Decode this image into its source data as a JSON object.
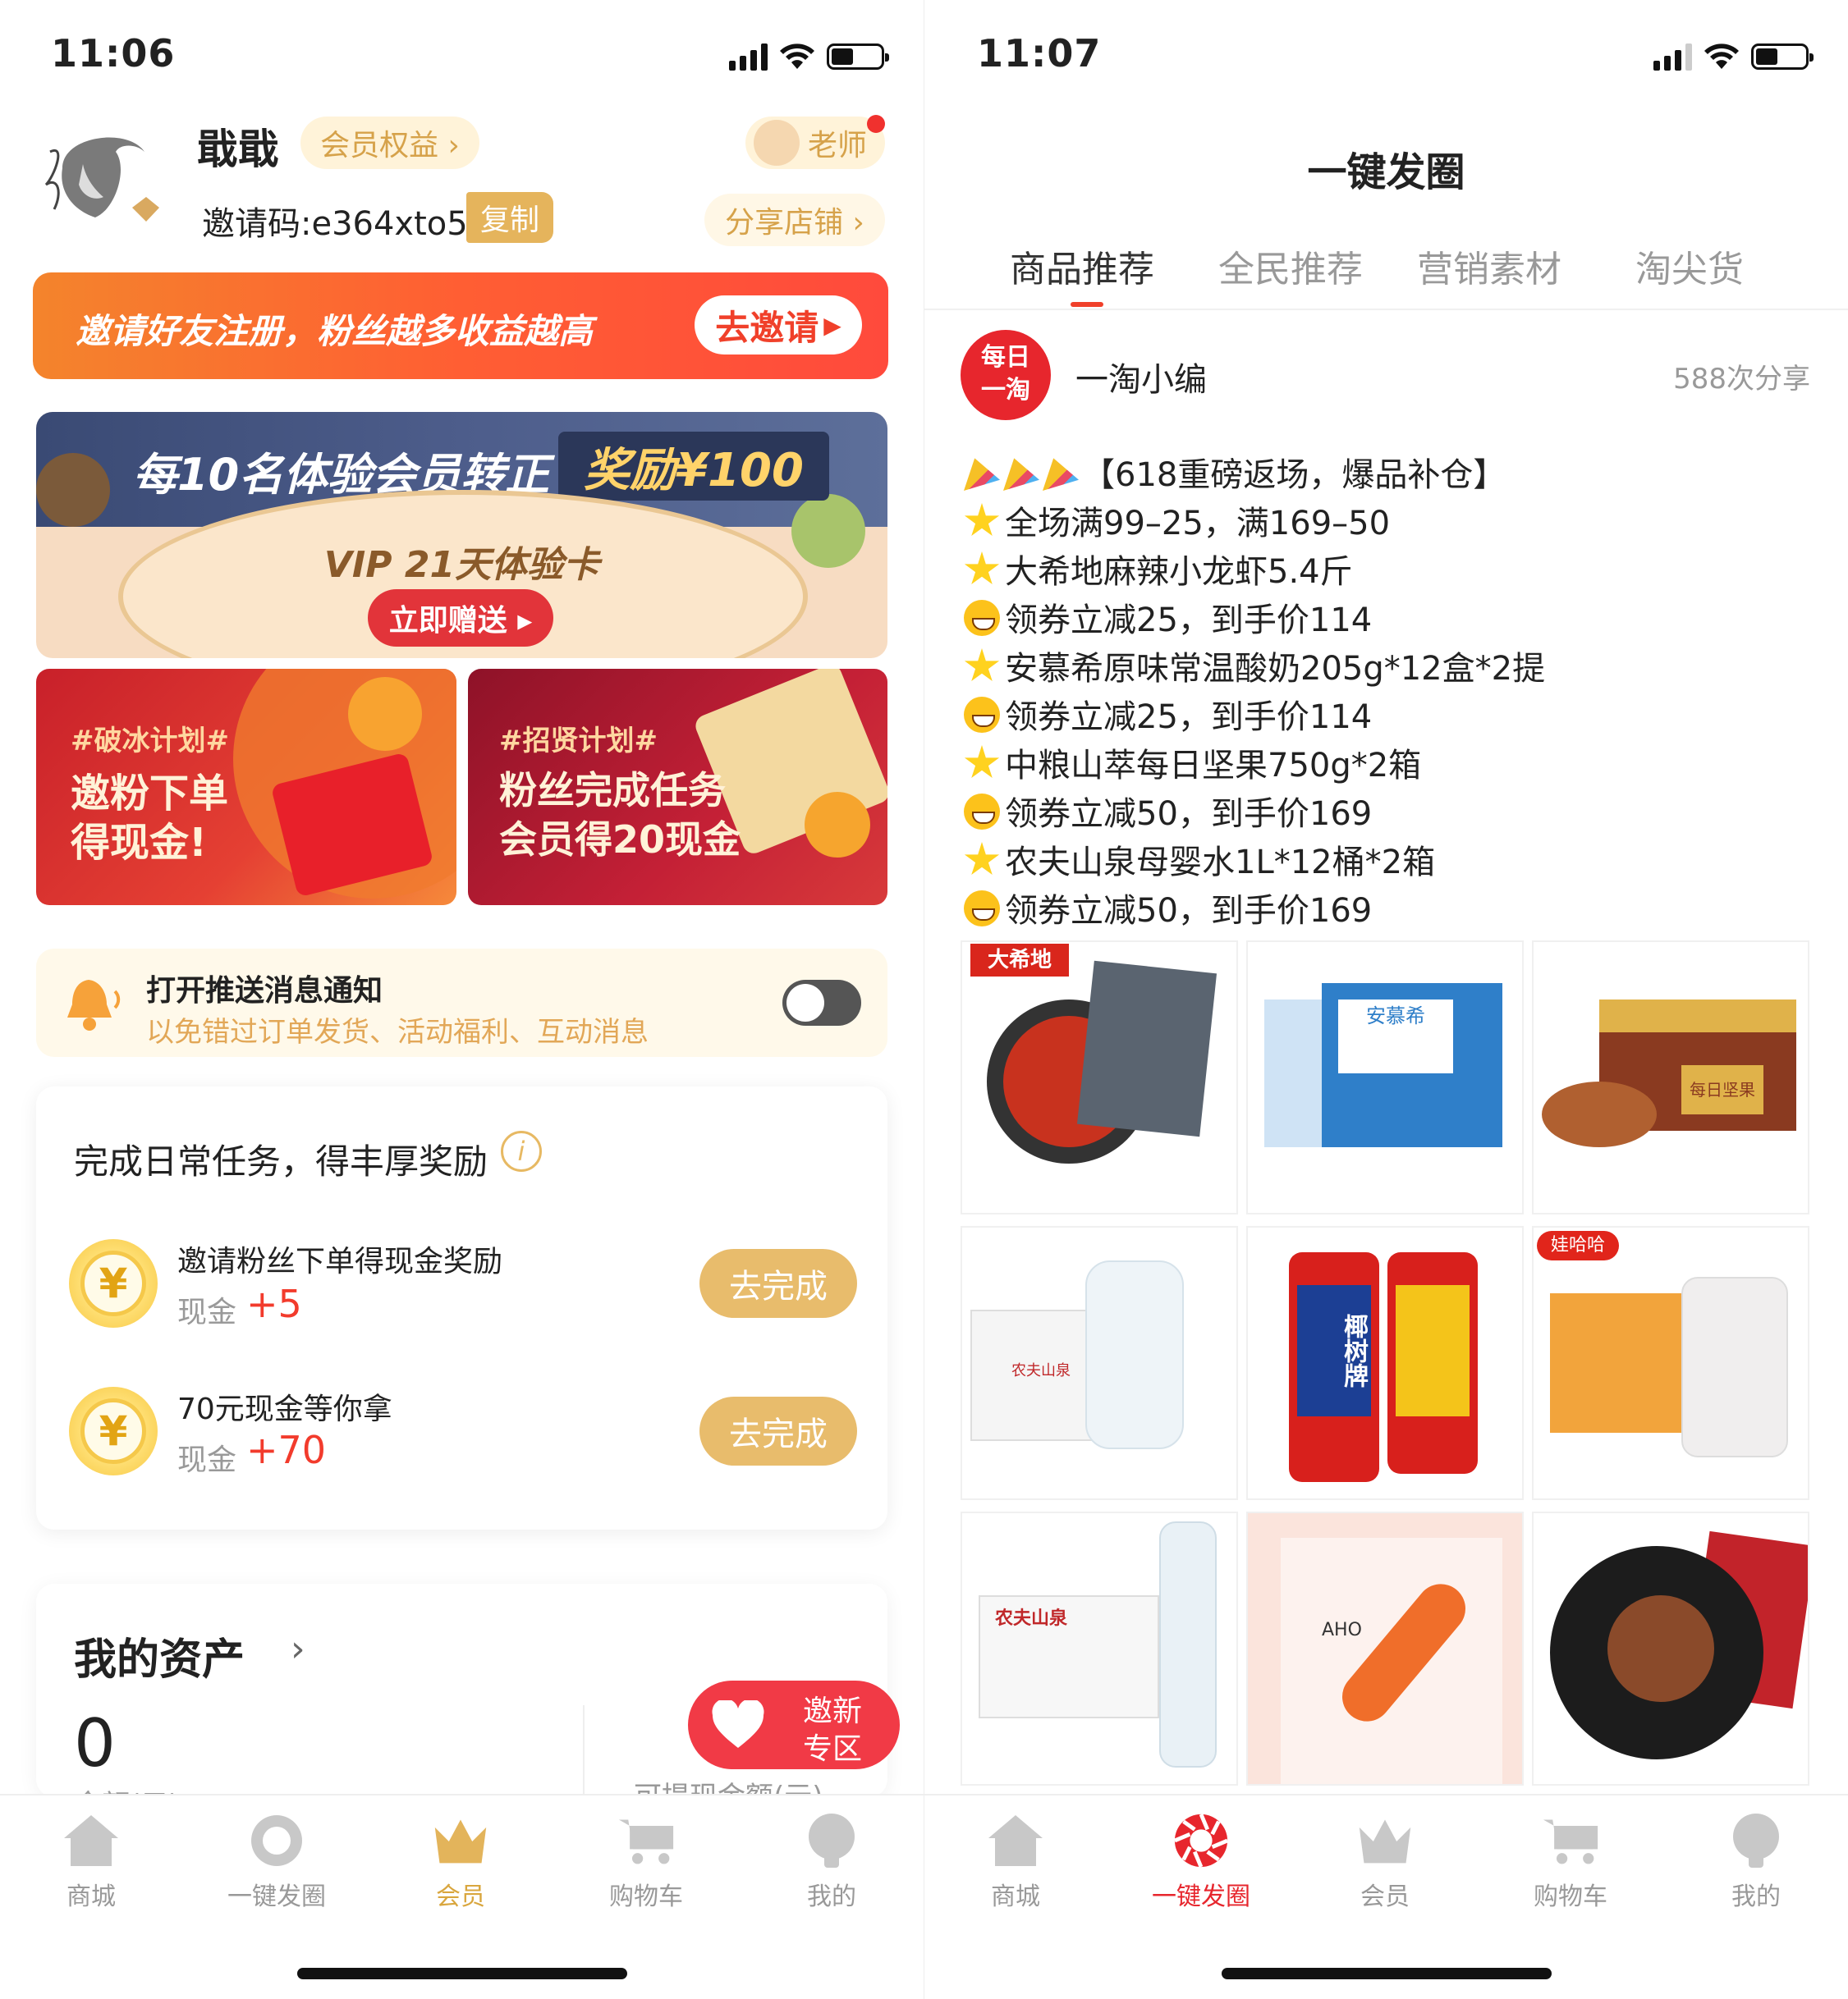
{
  "left": {
    "status": {
      "time": "11:06"
    },
    "profile": {
      "name": "戢戢",
      "member_rights": "会员权益 ›",
      "teacher": "老师",
      "invite_code_label": "邀请码:e364xto5",
      "copy": "复制",
      "share_shop": "分享店铺 ›"
    },
    "invite_banner": {
      "text": "邀请好友注册，粉丝越多收益越高",
      "button": "去邀请"
    },
    "vip_banner": {
      "headline": "每10名体验会员转正",
      "reward": "奖励¥100",
      "card": "VIP 21天体验卡",
      "button": "立即赠送 ▸"
    },
    "promo_cards": [
      {
        "tag": "#破冰计划#",
        "line1": "邀粉下单",
        "line2": "得现金!"
      },
      {
        "tag": "#招贤计划#",
        "line1": "粉丝完成任务",
        "line2": "会员得20现金"
      }
    ],
    "push_notice": {
      "title": "打开推送消息通知",
      "subtitle": "以免错过订单发货、活动福利、互动消息",
      "enabled": false
    },
    "tasks": {
      "title": "完成日常任务，得丰厚奖励",
      "items": [
        {
          "title": "邀请粉丝下单得现金奖励",
          "reward_label": "现金",
          "reward_value": "+5",
          "button": "去完成"
        },
        {
          "title": "70元现金等你拿",
          "reward_label": "现金",
          "reward_value": "+70",
          "button": "去完成"
        }
      ]
    },
    "assets": {
      "title": "我的资产",
      "balance": "0",
      "balance_label": "余额(元)",
      "withdrawable_label": "可提现金额(元)"
    },
    "float_button": {
      "line1": "邀新",
      "line2": "专区"
    },
    "tabbar": [
      {
        "label": "商城",
        "active": false
      },
      {
        "label": "一键发圈",
        "active": false
      },
      {
        "label": "会员",
        "active": true
      },
      {
        "label": "购物车",
        "active": false
      },
      {
        "label": "我的",
        "active": false
      }
    ]
  },
  "right": {
    "status": {
      "time": "11:07"
    },
    "title": "一键发圈",
    "tabs": [
      {
        "label": "商品推荐",
        "active": true
      },
      {
        "label": "全民推荐",
        "active": false
      },
      {
        "label": "营销素材",
        "active": false
      },
      {
        "label": "淘尖货",
        "active": false
      }
    ],
    "post": {
      "avatar_text": "每日一淘",
      "author": "一淘小编",
      "shares": "588次分享",
      "lines": [
        {
          "icon": "party",
          "text": "【618重磅返场，爆品补仓】"
        },
        {
          "icon": "star",
          "text": "全场满99–25，满169–50"
        },
        {
          "icon": "star",
          "text": "大希地麻辣小龙虾5.4斤"
        },
        {
          "icon": "smile",
          "text": "领券立减25，到手价114"
        },
        {
          "icon": "star",
          "text": "安慕希原味常温酸奶205g*12盒*2提"
        },
        {
          "icon": "smile",
          "text": "领券立减25，到手价114"
        },
        {
          "icon": "star",
          "text": "中粮山萃每日坚果750g*2箱"
        },
        {
          "icon": "smile",
          "text": "领券立减50，到手价169"
        },
        {
          "icon": "star",
          "text": "农夫山泉母婴水1L*12桶*2箱"
        },
        {
          "icon": "smile",
          "text": "领券立减50，到手价169"
        }
      ],
      "products": [
        {
          "name": "crayfish",
          "label": "大希地"
        },
        {
          "name": "yogurt",
          "label": "安慕希"
        },
        {
          "name": "nuts",
          "label": "每日坚果"
        },
        {
          "name": "baby-water",
          "label": "农夫山泉"
        },
        {
          "name": "coconut-juice",
          "label": "椰树牌"
        },
        {
          "name": "congee",
          "label": "娃哈哈"
        },
        {
          "name": "spring-water",
          "label": "农夫山泉"
        },
        {
          "name": "essence",
          "label": "AHO"
        },
        {
          "name": "steak",
          "label": ""
        }
      ]
    },
    "tabbar": [
      {
        "label": "商城",
        "active": false
      },
      {
        "label": "一键发圈",
        "active": true
      },
      {
        "label": "会员",
        "active": false
      },
      {
        "label": "购物车",
        "active": false
      },
      {
        "label": "我的",
        "active": false
      }
    ]
  },
  "colors": {
    "accent_red": "#f0402a",
    "gold": "#e8bc6c",
    "tab_active": "#d9a63e"
  }
}
